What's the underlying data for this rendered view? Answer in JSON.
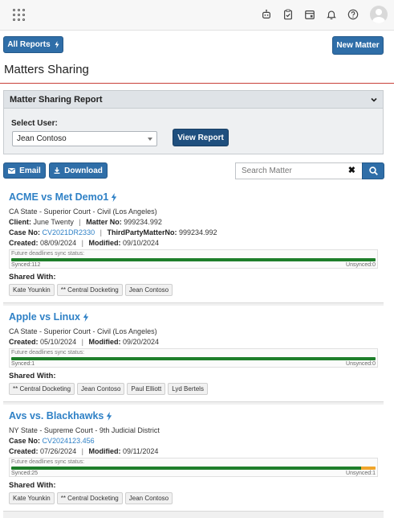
{
  "header": {
    "icons": [
      "app-launcher-icon",
      "robot-icon",
      "clipboard-check-icon",
      "calendar-icon",
      "bell-icon",
      "help-icon",
      "user-avatar-icon"
    ]
  },
  "actions": {
    "all_reports_label": "All Reports",
    "new_matter_label": "New Matter"
  },
  "page": {
    "title": "Matters Sharing"
  },
  "report_panel": {
    "title": "Matter Sharing Report",
    "select_user_label": "Select User:",
    "selected_user": "Jean Contoso",
    "view_report_label": "View Report"
  },
  "toolbar": {
    "email_label": "Email",
    "download_label": "Download",
    "search_placeholder": "Search Matter",
    "clear_symbol": "✖"
  },
  "labels": {
    "client": "Client:",
    "matter_no": "Matter No:",
    "case_no": "Case No:",
    "third_party_matter_no": "ThirdPartyMatterNo:",
    "created": "Created:",
    "modified": "Modified:",
    "sync_status": "Future deadlines sync status:",
    "shared_with": "Shared With:",
    "separator": "|"
  },
  "matters": [
    {
      "title": "ACME vs Met Demo1",
      "court": "CA State - Superior Court - Civil (Los Angeles)",
      "client": "June Twenty",
      "matter_no": "999234.992",
      "case_no": "CV2021DR2330",
      "third_party_matter_no": "999234.992",
      "created": "08/09/2024",
      "modified": "09/10/2024",
      "synced_text": "Synced:112",
      "unsynced_text": "Unsynced:0",
      "synced_fraction": 1.0,
      "shared_with": [
        "Kate Younkin",
        "** Central Docketing",
        "Jean Contoso"
      ]
    },
    {
      "title": "Apple vs Linux",
      "court": "CA State - Superior Court - Civil (Los Angeles)",
      "created": "05/10/2024",
      "modified": "09/20/2024",
      "synced_text": "Synced:1",
      "unsynced_text": "Unsynced:0",
      "synced_fraction": 1.0,
      "shared_with": [
        "** Central Docketing",
        "Jean Contoso",
        "Paul Elliott",
        "Lyd Bertels"
      ]
    },
    {
      "title": "Avs vs. Blackhawks",
      "court": "NY State - Supreme Court - 9th Judicial District",
      "case_no": "CV2024123.456",
      "created": "07/26/2024",
      "modified": "09/11/2024",
      "synced_text": "Synced:25",
      "unsynced_text": "Unsynced:1",
      "synced_fraction": 0.96,
      "shared_with": [
        "Kate Younkin",
        "** Central Docketing",
        "Jean Contoso"
      ]
    }
  ],
  "colors": {
    "primary": "#2f6ea8",
    "link": "#2f81c6",
    "synced": "#1e7e2a",
    "unsynced": "#f0a52b",
    "accent_rule": "#c9413a"
  }
}
